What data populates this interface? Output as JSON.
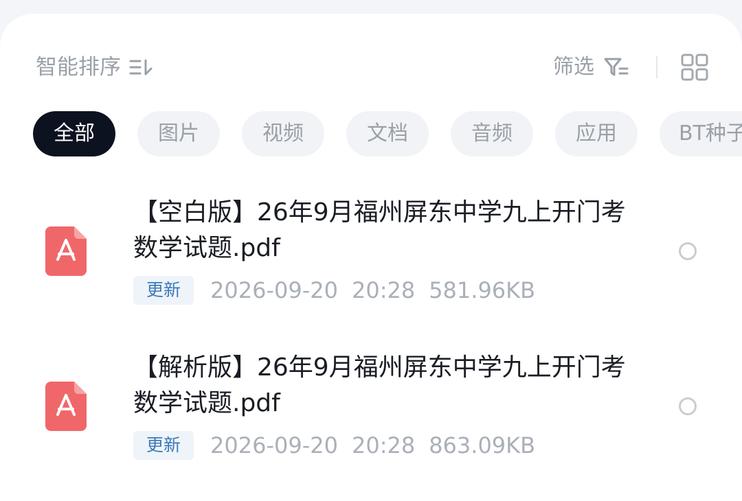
{
  "toolbar": {
    "sort_label": "智能排序",
    "sort_icon": "sort-order-icon",
    "filter_label": "筛选",
    "filter_icon": "filter-funnel-icon",
    "view_icon": "grid-view-icon"
  },
  "chips": [
    {
      "label": "全部",
      "active": true
    },
    {
      "label": "图片",
      "active": false
    },
    {
      "label": "视频",
      "active": false
    },
    {
      "label": "文档",
      "active": false
    },
    {
      "label": "音频",
      "active": false
    },
    {
      "label": "应用",
      "active": false
    },
    {
      "label": "BT种子",
      "active": false
    }
  ],
  "files": [
    {
      "name": "【空白版】26年9月福州屏东中学九上开门考数学试题.pdf",
      "badge": "更新",
      "date": "2026-09-20",
      "time": "20:28",
      "size": "581.96KB",
      "icon": "pdf-file-icon"
    },
    {
      "name": "【解析版】26年9月福州屏东中学九上开门考数学试题.pdf",
      "badge": "更新",
      "date": "2026-09-20",
      "time": "20:28",
      "size": "863.09KB",
      "icon": "pdf-file-icon"
    }
  ],
  "colors": {
    "chip_active_bg": "#0d1220",
    "chip_bg": "#f1f3f6",
    "pdf_red": "#f0676a",
    "badge_text": "#3b79b8"
  }
}
